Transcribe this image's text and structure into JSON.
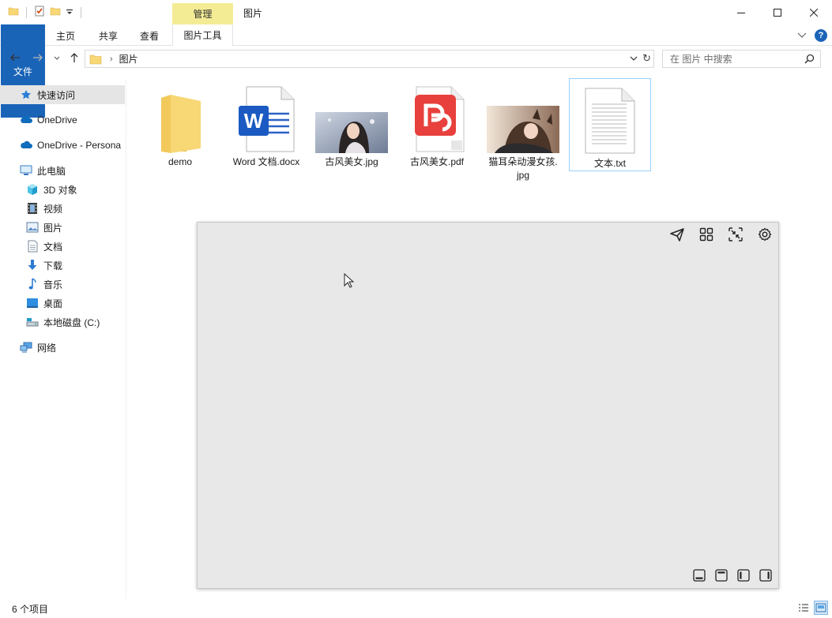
{
  "window": {
    "title": "图片",
    "context_tab_header": "管理"
  },
  "ribbon": {
    "tabs": [
      {
        "label": "文件"
      },
      {
        "label": "主页"
      },
      {
        "label": "共享"
      },
      {
        "label": "查看"
      },
      {
        "label": "图片工具"
      }
    ],
    "help_label": "?"
  },
  "address": {
    "path": [
      "图片"
    ],
    "search_placeholder": "在 图片 中搜索"
  },
  "nav_pane": {
    "items": [
      {
        "label": "快速访问",
        "icon": "star-icon"
      },
      {
        "label": "OneDrive",
        "icon": "cloud-icon"
      },
      {
        "label": "OneDrive - Persona",
        "icon": "cloud-icon"
      },
      {
        "label": "此电脑",
        "icon": "pc-icon"
      },
      {
        "label": "3D 对象",
        "icon": "cube-icon"
      },
      {
        "label": "视频",
        "icon": "film-icon"
      },
      {
        "label": "图片",
        "icon": "picture-icon"
      },
      {
        "label": "文档",
        "icon": "document-icon"
      },
      {
        "label": "下载",
        "icon": "download-arrow-icon"
      },
      {
        "label": "音乐",
        "icon": "music-note-icon"
      },
      {
        "label": "桌面",
        "icon": "desktop-icon"
      },
      {
        "label": "本地磁盘 (C:)",
        "icon": "drive-icon"
      },
      {
        "label": "网络",
        "icon": "network-icon"
      }
    ]
  },
  "files": [
    {
      "name": "demo",
      "type": "folder"
    },
    {
      "name": "Word 文档.docx",
      "type": "docx"
    },
    {
      "name": "古风美女.jpg",
      "type": "jpg"
    },
    {
      "name": "古风美女.pdf",
      "type": "pdf"
    },
    {
      "name_line1": "猫耳朵动漫女孩.",
      "name_line2": "jpg",
      "type": "jpg"
    },
    {
      "name": "文本.txt",
      "type": "txt"
    }
  ],
  "colors": {
    "accent": "#1a64b8",
    "context_tab": "#f3ec95",
    "selection_border": "#99d1ff",
    "panel_bg": "#e8e8e8"
  },
  "status": {
    "count": "6 个项目"
  }
}
